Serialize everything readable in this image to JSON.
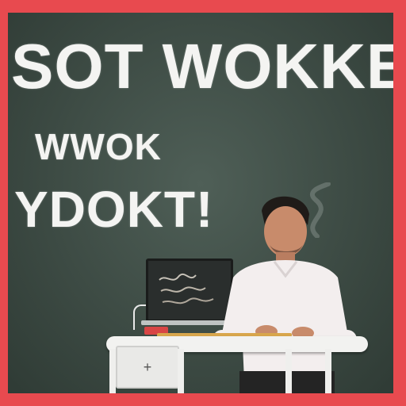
{
  "headline": {
    "line1": "SOT WOKKE",
    "line2": "WWOK",
    "line3": "YDOKT!"
  },
  "colors": {
    "frame": "#e84a4f",
    "board": "#3d4b44",
    "text": "#f4f4f2",
    "shirt": "#f3eeee",
    "desk": "#f2f2f0"
  },
  "icons": {
    "drawer_handle": "plus-icon"
  },
  "drawer_handle_glyph": "+"
}
